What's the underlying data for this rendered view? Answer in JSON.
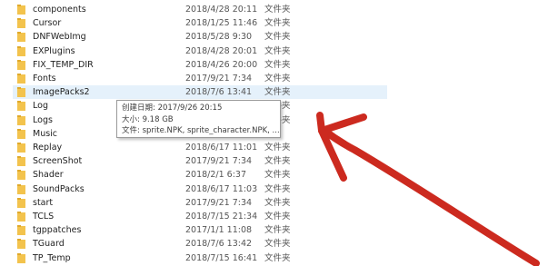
{
  "folder_type": "文件夹",
  "rows": [
    {
      "name": "components",
      "date": "2018/4/28 20:11",
      "type": "文件夹"
    },
    {
      "name": "Cursor",
      "date": "2018/1/25 11:46",
      "type": "文件夹"
    },
    {
      "name": "DNFWebImg",
      "date": "2018/5/28 9:30",
      "type": "文件夹"
    },
    {
      "name": "EXPlugins",
      "date": "2018/4/28 20:01",
      "type": "文件夹"
    },
    {
      "name": "FIX_TEMP_DIR",
      "date": "2018/4/26 20:00",
      "type": "文件夹"
    },
    {
      "name": "Fonts",
      "date": "2017/9/21 7:34",
      "type": "文件夹"
    },
    {
      "name": "ImagePacks2",
      "date": "2018/7/6 13:41",
      "type": "文件夹",
      "selected": true
    },
    {
      "name": "Log",
      "date": "",
      "type": "文件夹"
    },
    {
      "name": "Logs",
      "date": "",
      "type": "文件夹"
    },
    {
      "name": "Music",
      "date": "",
      "type": ""
    },
    {
      "name": "Replay",
      "date": "2018/6/17 11:01",
      "type": "文件夹"
    },
    {
      "name": "ScreenShot",
      "date": "2017/9/21 7:34",
      "type": "文件夹"
    },
    {
      "name": "Shader",
      "date": "2018/2/1 6:37",
      "type": "文件夹"
    },
    {
      "name": "SoundPacks",
      "date": "2018/6/17 11:03",
      "type": "文件夹"
    },
    {
      "name": "start",
      "date": "2017/9/21 7:34",
      "type": "文件夹"
    },
    {
      "name": "TCLS",
      "date": "2018/7/15 21:34",
      "type": "文件夹"
    },
    {
      "name": "tgppatches",
      "date": "2017/1/1 11:08",
      "type": "文件夹"
    },
    {
      "name": "TGuard",
      "date": "2018/7/6 13:42",
      "type": "文件夹"
    },
    {
      "name": "TP_Temp",
      "date": "2018/7/15 16:41",
      "type": "文件夹"
    }
  ],
  "tooltip": {
    "created": "创建日期: 2017/9/26 20:15",
    "size": "大小: 9.18 GB",
    "files": "文件: sprite.NPK, sprite_character.NPK, ..."
  },
  "colors": {
    "folder_yellow": "#f3c34d",
    "selection": "#e5f1fb",
    "annotation_arrow": "#cc2a1f"
  },
  "icons": {
    "folder": "folder-icon"
  }
}
